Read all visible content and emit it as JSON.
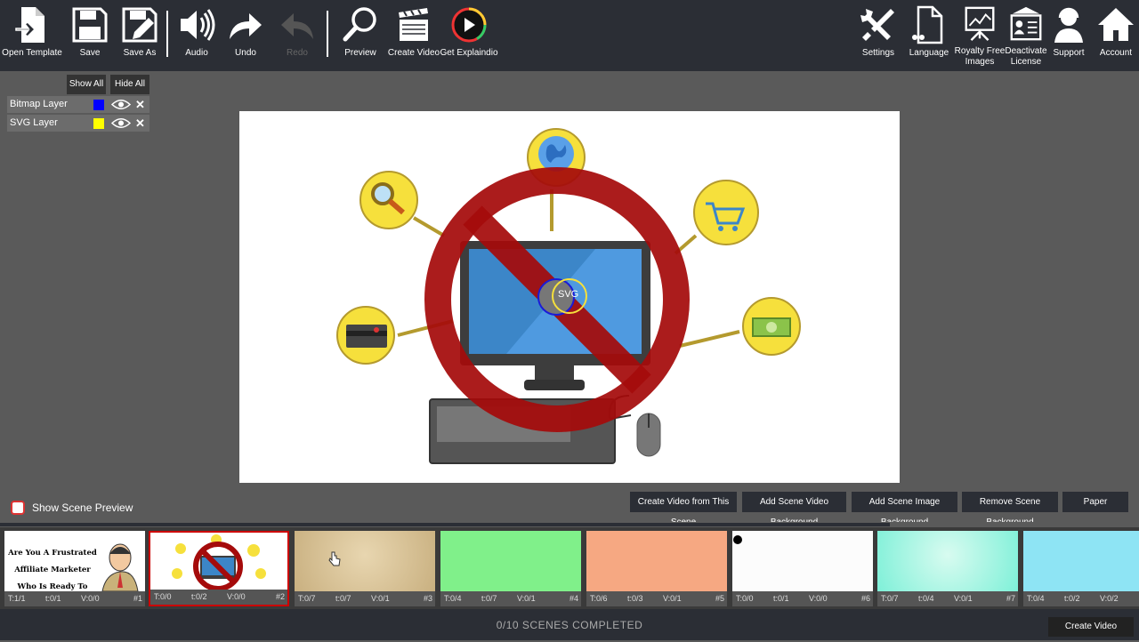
{
  "toolbar": {
    "open_template": "Open Template",
    "save": "Save",
    "save_as": "Save As",
    "audio": "Audio",
    "undo": "Undo",
    "redo": "Redo",
    "preview": "Preview",
    "create_video": "Create Video",
    "get_explaindio": "Get Explaindio",
    "settings": "Settings",
    "language": "Language",
    "royalty_free": "Royalty Free\nImages",
    "deactivate": "Deactivate\nLicense",
    "support": "Support",
    "account": "Account"
  },
  "layers": {
    "show_all": "Show All",
    "hide_all": "Hide All",
    "items": [
      {
        "name": "Bitmap Layer",
        "color": "#0000ff"
      },
      {
        "name": "SVG Layer",
        "color": "#ffff00"
      }
    ]
  },
  "canvas": {
    "svg_badge": "SVG"
  },
  "scene_controls": {
    "show_scene_preview": "Show Scene Preview",
    "create_from_scene": "Create Video from This Scene",
    "add_video_bg": "Add Scene Video Background",
    "add_image_bg": "Add Scene Image Background",
    "remove_bg": "Remove Scene Background",
    "paper": "Paper"
  },
  "scenes": [
    {
      "t": "T:1/1",
      "i": "t:0/1",
      "v": "V:0/0",
      "num": "#1",
      "thumb_text": "Are You A Frustrated Affiliate Marketer Who Is Ready To Give Up?"
    },
    {
      "t": "T:0/0",
      "i": "t:0/2",
      "v": "V:0/0",
      "num": "#2"
    },
    {
      "t": "T:0/7",
      "i": "t:0/7",
      "v": "V:0/1",
      "num": "#3"
    },
    {
      "t": "T:0/4",
      "i": "t:0/7",
      "v": "V:0/1",
      "num": "#4"
    },
    {
      "t": "T:0/6",
      "i": "t:0/3",
      "v": "V:0/1",
      "num": "#5"
    },
    {
      "t": "T:0/0",
      "i": "t:0/1",
      "v": "V:0/0",
      "num": "#6"
    },
    {
      "t": "T:0/7",
      "i": "t:0/4",
      "v": "V:0/1",
      "num": "#7"
    },
    {
      "t": "T:0/4",
      "i": "t:0/2",
      "v": "V:0/2",
      "num": ""
    }
  ],
  "footer": {
    "status": "0/10  SCENES COMPLETED",
    "create_video": "Create Video"
  },
  "colors": {
    "toolbar_bg": "#2b2e35",
    "workspace_bg": "#5a5a5a",
    "selected_scene_border": "#cc0000",
    "prohibition_red": "#a50b0b",
    "icon_yellow": "#f6e03c"
  }
}
